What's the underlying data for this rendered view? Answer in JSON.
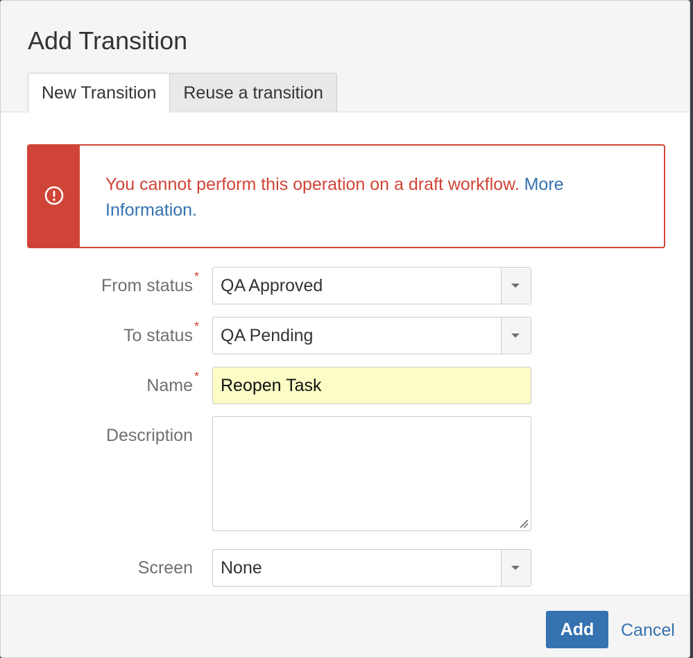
{
  "dialog": {
    "title": "Add Transition"
  },
  "tabs": [
    {
      "label": "New Transition",
      "active": true
    },
    {
      "label": "Reuse a transition",
      "active": false
    }
  ],
  "error": {
    "icon": "exclamation-circle-icon",
    "message": "You cannot perform this operation on a draft workflow.",
    "link_text": "More Information.",
    "color": "#d04437"
  },
  "form": {
    "from_status": {
      "label": "From status",
      "required_mark": "*",
      "value": "QA Approved"
    },
    "to_status": {
      "label": "To status",
      "required_mark": "*",
      "value": "QA Pending"
    },
    "name": {
      "label": "Name",
      "required_mark": "*",
      "value": "Reopen Task"
    },
    "description": {
      "label": "Description",
      "value": ""
    },
    "screen": {
      "label": "Screen",
      "value": "None"
    }
  },
  "footer": {
    "add_label": "Add",
    "cancel_label": "Cancel",
    "primary_color": "#3572b0"
  }
}
